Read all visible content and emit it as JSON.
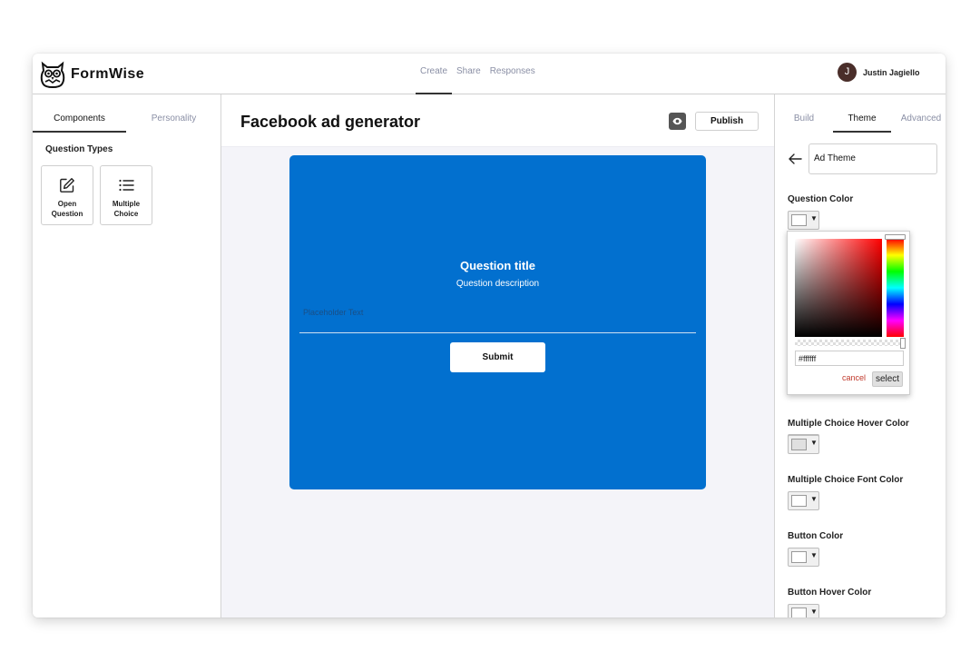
{
  "app": {
    "name": "FormWise"
  },
  "topnav": {
    "tabs": [
      "Create",
      "Share",
      "Responses"
    ],
    "active": "Create"
  },
  "user": {
    "initial": "J",
    "name": "Justin Jagiello"
  },
  "left_panel": {
    "tabs": [
      "Components",
      "Personality"
    ],
    "section_title": "Question Types",
    "components": [
      {
        "label": "Open Question",
        "icon": "edit-icon"
      },
      {
        "label": "Multiple Choice",
        "icon": "list-icon"
      }
    ]
  },
  "center": {
    "form_title": "Facebook ad generator",
    "publish_label": "Publish",
    "preview": {
      "question_title": "Question title",
      "question_description": "Question description",
      "placeholder": "Placeholder Text",
      "submit_label": "Submit",
      "background_color": "#0270cf"
    }
  },
  "right_panel": {
    "tabs": [
      "Build",
      "Theme",
      "Advanced"
    ],
    "active_tab": "Theme",
    "theme_name": "Ad Theme",
    "color_settings": [
      {
        "label": "Question Color",
        "swatch": "#ffffff"
      },
      {
        "label": "Multiple Choice Hover Color",
        "swatch": "#e0e0e0"
      },
      {
        "label": "Multiple Choice Font Color",
        "swatch": "#ffffff"
      },
      {
        "label": "Button Color",
        "swatch": "#ffffff"
      },
      {
        "label": "Button Hover Color",
        "swatch": "#ffffff"
      }
    ]
  },
  "color_picker": {
    "hex_value": "#ffffff",
    "cancel_label": "cancel",
    "select_label": "select"
  }
}
